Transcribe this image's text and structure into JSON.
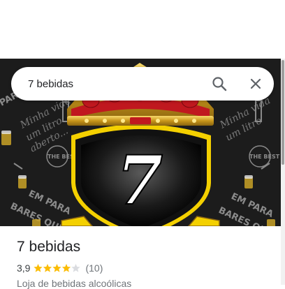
{
  "search": {
    "value": "7 bebidas",
    "search_icon": "search-icon",
    "close_icon": "close-icon"
  },
  "hero": {
    "logo_text": "7",
    "background_texts": [
      "Minha vida",
      "um litro",
      "aberto...",
      "EM PARA",
      "BARES QUE",
      "THE BEST BEER",
      "PARA"
    ]
  },
  "place": {
    "title": "7 bebidas",
    "rating": "3,9",
    "rating_value": 3.9,
    "stars_total": 5,
    "review_count": "(10)",
    "category": "Loja de bebidas alcoólicas"
  },
  "colors": {
    "star": "#fbbc04",
    "star_empty": "#dadce0",
    "crown_gold": "#d4a017",
    "crown_red": "#c0181f",
    "shield_yellow": "#f4d000"
  }
}
